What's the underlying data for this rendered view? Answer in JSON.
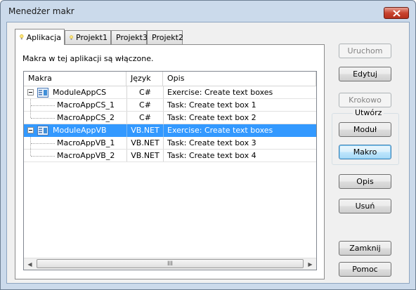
{
  "window": {
    "title": "Menedżer makr"
  },
  "tabs": [
    {
      "label": "Aplikacja",
      "icon": "lightbulb-icon",
      "active": true
    },
    {
      "label": "Projekt1",
      "icon": "lightbulb-icon",
      "active": false
    },
    {
      "label": "Projekt3",
      "active": false
    },
    {
      "label": "Projekt2",
      "active": false
    }
  ],
  "info_text": "Makra w tej aplikacji są włączone.",
  "list": {
    "columns": [
      "Makra",
      "Język",
      "Opis"
    ],
    "rows": [
      {
        "name": "ModuleAppCS",
        "lang": "C#",
        "desc": "Exercise: Create text boxes",
        "type": "module",
        "selected": false
      },
      {
        "name": "MacroAppCS_1",
        "lang": "C#",
        "desc": "Task: Create text box 1",
        "type": "macro",
        "selected": false
      },
      {
        "name": "MacroAppCS_2",
        "lang": "C#",
        "desc": "Task: Create text box 2",
        "type": "macro",
        "selected": false
      },
      {
        "name": "ModuleAppVB",
        "lang": "VB.NET",
        "desc": "Exercise: Create text boxes",
        "type": "module",
        "selected": true
      },
      {
        "name": "MacroAppVB_1",
        "lang": "VB.NET",
        "desc": "Task: Create text box 3",
        "type": "macro",
        "selected": false
      },
      {
        "name": "MacroAppVB_2",
        "lang": "VB.NET",
        "desc": "Task: Create text box 4",
        "type": "macro",
        "selected": false
      }
    ],
    "scroll_grip": "III"
  },
  "buttons": {
    "run": "Uruchom",
    "edit": "Edytuj",
    "step": "Krokowo",
    "create_group": "Utwórz",
    "module": "Moduł",
    "macro": "Makro",
    "description": "Opis",
    "delete": "Usuń",
    "close": "Zamknij",
    "help": "Pomoc"
  },
  "colors": {
    "selection": "#3399ff",
    "title_bar": "#cbdaeb",
    "close_button": "#c8442f"
  }
}
